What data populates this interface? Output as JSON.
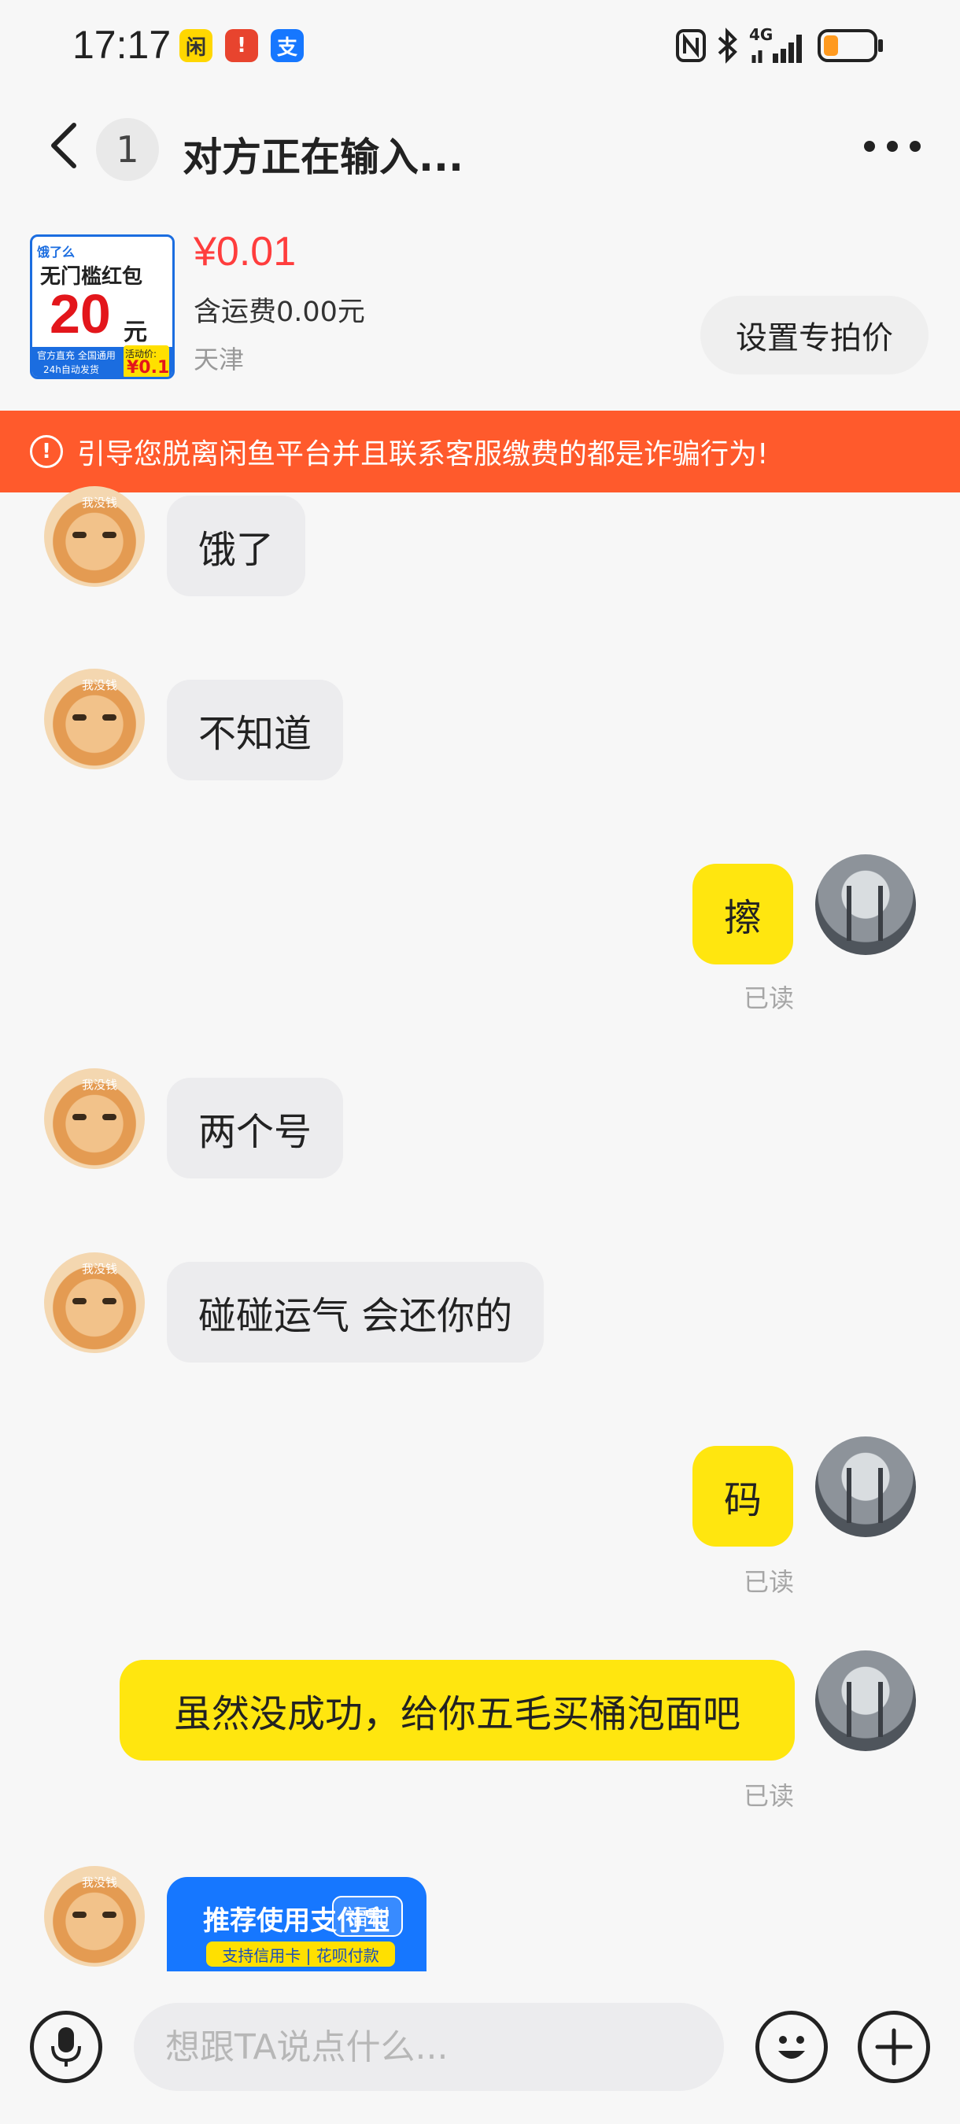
{
  "status_bar": {
    "time": "17:17",
    "app_icons": [
      {
        "name": "xianyu-app-icon",
        "color": "#ffd700",
        "glyph": "闲"
      },
      {
        "name": "alert-app-icon",
        "color": "#e8442e",
        "glyph": "!"
      },
      {
        "name": "alipay-app-icon",
        "color": "#1677ff",
        "glyph": "支"
      }
    ],
    "network_label": "4G",
    "battery_level": 0.15
  },
  "header": {
    "unread_count": "1",
    "title": "对方正在输入..."
  },
  "product": {
    "thumb": {
      "brand": "饿了么",
      "headline": "无门槛红包",
      "amount": "20",
      "unit": "元",
      "tags": "官方直充 全国通用",
      "delivery": "24h自动发货",
      "promo_label": "活动价:",
      "promo_price": "¥0.1"
    },
    "price": "¥0.01",
    "shipping": "含运费0.00元",
    "location": "天津",
    "set_price_button": "设置专拍价"
  },
  "warning": {
    "text": "引导您脱离闲鱼平台并且联系客服缴费的都是诈骗行为!"
  },
  "messages": [
    {
      "side": "in",
      "text": "饿了"
    },
    {
      "side": "in",
      "text": "不知道"
    },
    {
      "side": "out",
      "text": "擦",
      "status": "已读"
    },
    {
      "side": "in",
      "text": "两个号"
    },
    {
      "side": "in",
      "text": "碰碰运气 会还你的"
    },
    {
      "side": "out",
      "text": "码",
      "status": "已读"
    },
    {
      "side": "out",
      "text": "虽然没成功，给你五毛买桶泡面吧",
      "status": "已读"
    }
  ],
  "card_message": {
    "title": "推荐使用支付宝",
    "badge": "福利",
    "subtitle": "支持信用卡 | 花呗付款"
  },
  "input": {
    "placeholder": "想跟TA说点什么..."
  },
  "avatar_tag": "我没钱"
}
